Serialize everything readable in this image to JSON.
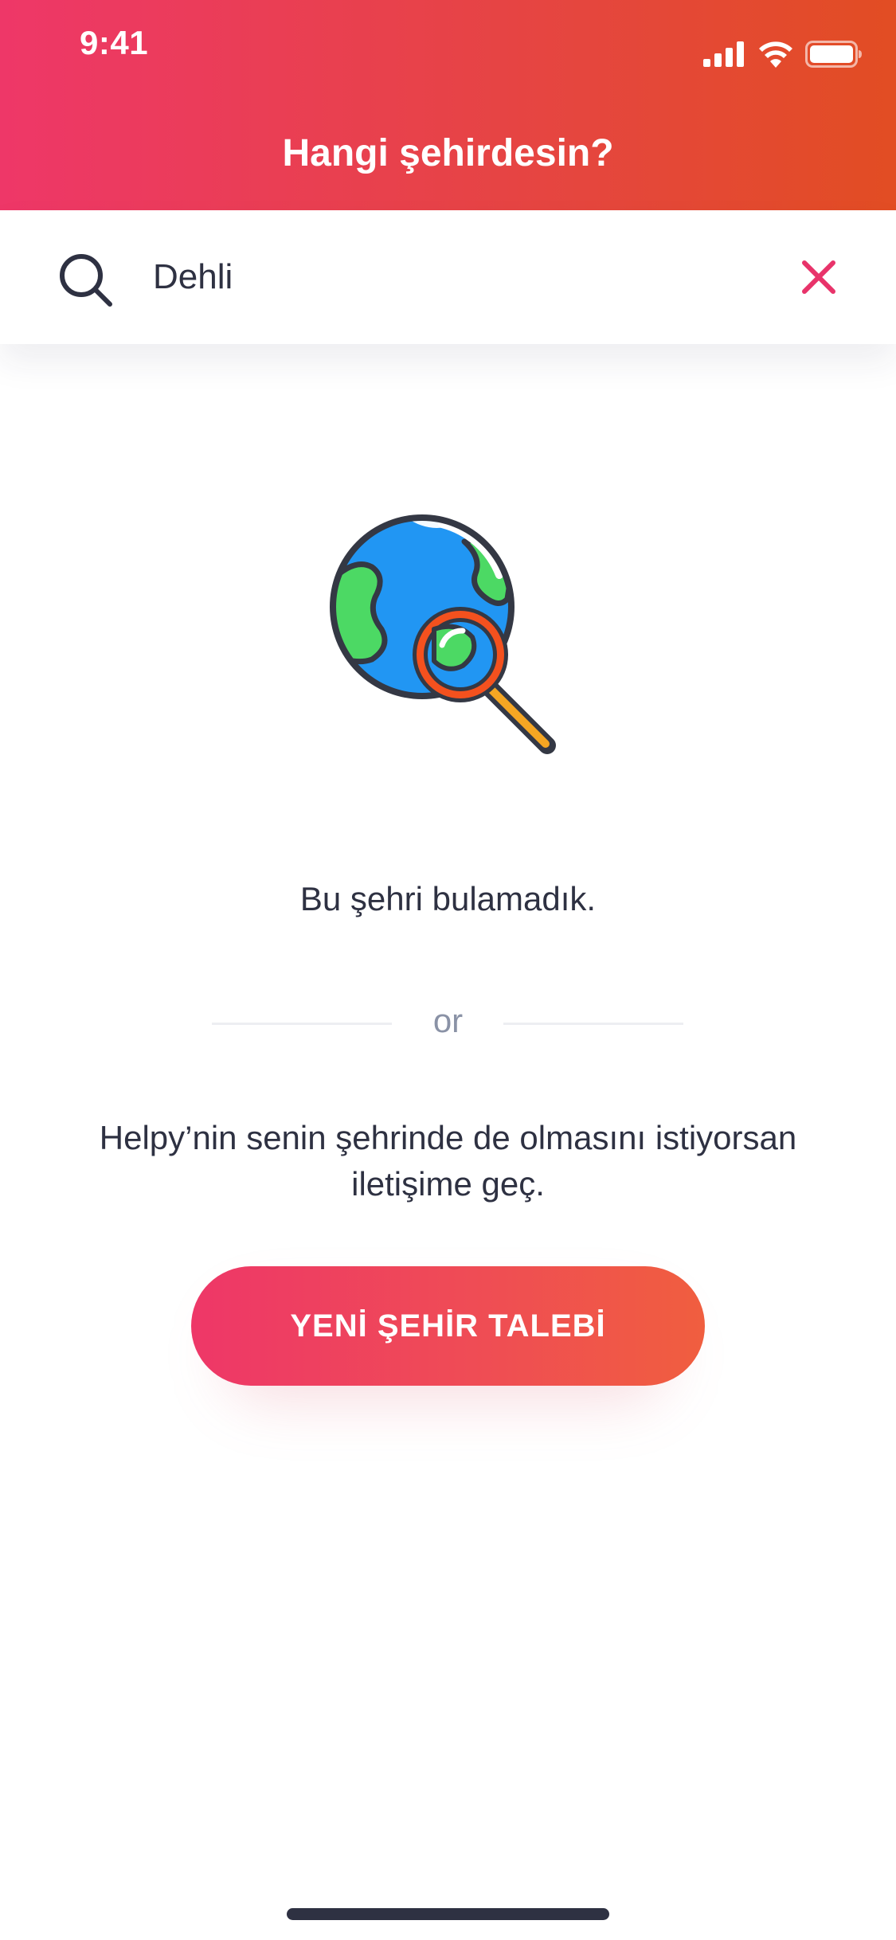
{
  "status_bar": {
    "time": "9:41",
    "icons": [
      "signal-icon",
      "wifi-icon",
      "battery-icon"
    ]
  },
  "header": {
    "title": "Hangi şehirdesin?"
  },
  "search": {
    "value": "Dehli",
    "icon": "search-icon",
    "clear_icon": "close-icon"
  },
  "empty_state": {
    "illustration": "globe-magnifier-icon",
    "message": "Bu şehri bulamadık.",
    "divider_label": "or",
    "contact_message": "Helpy’nin senin şehrinde de olmasını istiyorsan iletişime geç.",
    "cta_label": "YENİ ŞEHİR TALEBİ"
  },
  "colors": {
    "brand_pink": "#EE3768",
    "brand_orange": "#E24D23",
    "text_dark": "#2E3142",
    "text_muted": "#8A92A6",
    "clear_icon": "#E8336A"
  }
}
